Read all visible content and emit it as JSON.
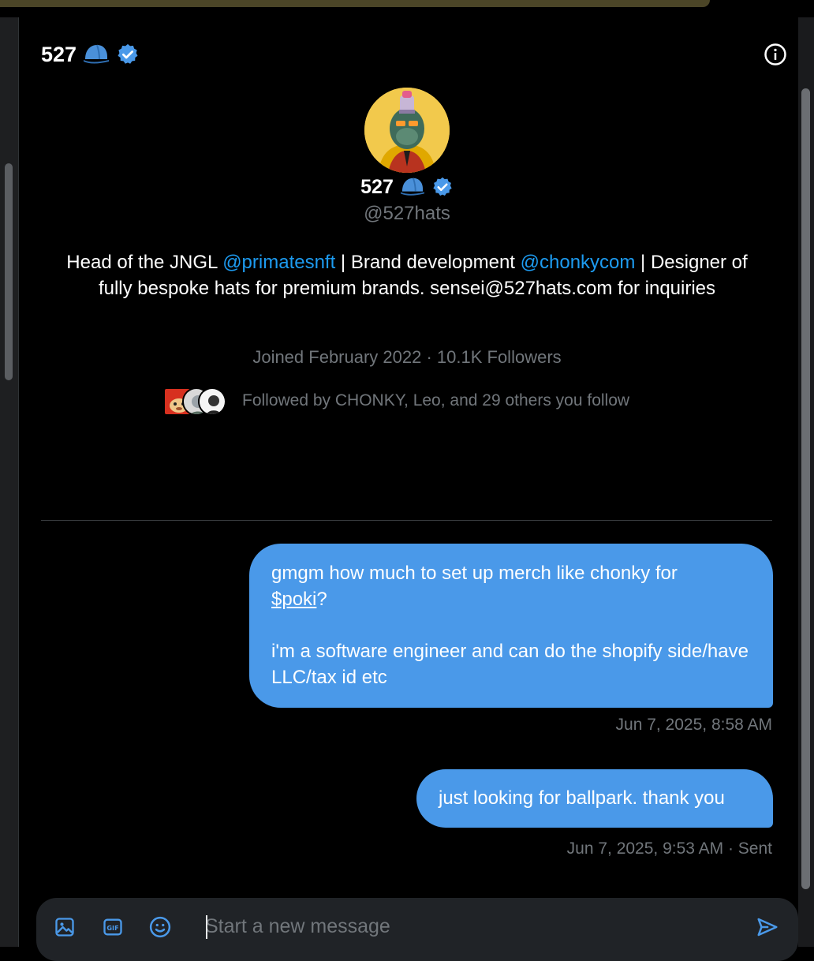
{
  "header": {
    "title": "527"
  },
  "profile": {
    "name": "527",
    "handle": "@527hats",
    "bio": {
      "part1": "Head of the JNGL ",
      "mention1": "@primatesnft",
      "part2": "  | Brand development ",
      "mention2": "@chonkycom",
      "part3": " | Designer of fully bespoke hats for premium brands.  sensei@527hats.com for inquiries"
    },
    "joined": "Joined February 2022 · 10.1K Followers",
    "followed_by": "Followed by CHONKY, Leo, and 29 others you follow"
  },
  "messages": [
    {
      "line1": "gmgm how much to set up merch like chonky for",
      "ticker": "$poki",
      "after_ticker": "?",
      "line3": "i'm a software engineer and can do the shopify side/have LLC/tax id etc",
      "timestamp": "Jun 7, 2025, 8:58 AM"
    },
    {
      "text": "just looking for ballpark. thank you",
      "timestamp": "Jun 7, 2025, 9:53 AM · Sent"
    }
  ],
  "composer": {
    "placeholder": "Start a new message",
    "icons": [
      "image-icon",
      "gif-icon",
      "emoji-icon",
      "send-icon"
    ]
  },
  "colors": {
    "accent": "#1d9bf0",
    "bubble": "#4a99e9",
    "muted": "#71767b",
    "background": "#000000"
  }
}
